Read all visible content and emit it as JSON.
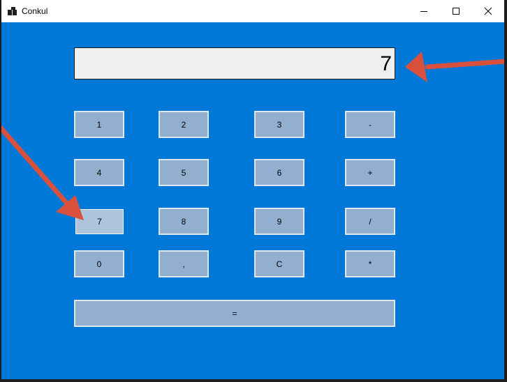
{
  "window": {
    "title": "Conkul",
    "icons": {
      "app": "app-icon",
      "minimize": "minimize-icon",
      "maximize": "maximize-icon",
      "close": "close-icon"
    }
  },
  "calculator": {
    "display_value": "7",
    "buttons": {
      "b1": "1",
      "b2": "2",
      "b3": "3",
      "minus": "-",
      "b4": "4",
      "b5": "5",
      "b6": "6",
      "plus": "+",
      "b7": "7",
      "b8": "8",
      "b9": "9",
      "divide": "/",
      "b0": "0",
      "comma": ",",
      "clear": "C",
      "multiply": "*",
      "equals": "="
    }
  },
  "colors": {
    "window_background": "#0078d7",
    "button_fill": "#93afd0",
    "annotation_arrow": "#d9513d"
  }
}
